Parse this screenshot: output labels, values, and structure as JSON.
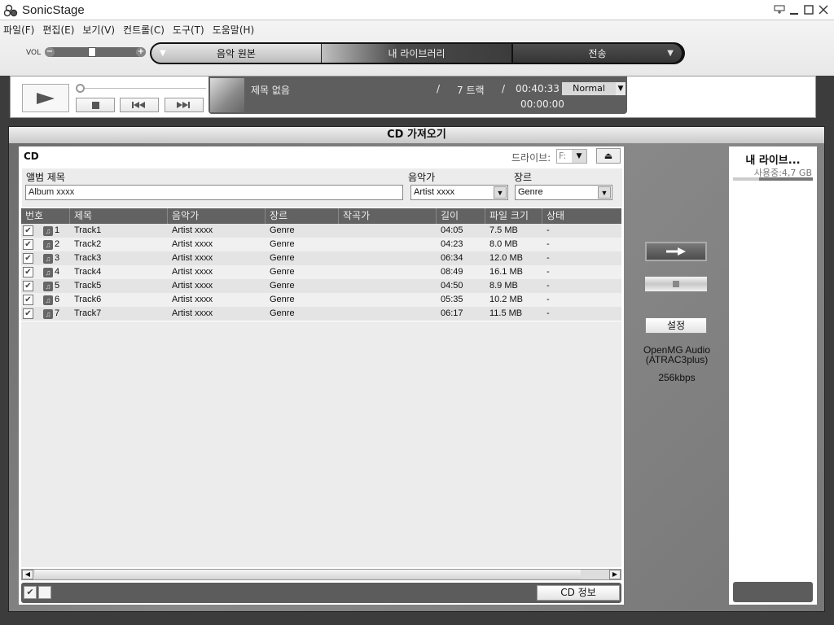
{
  "app": {
    "title": "SonicStage",
    "window_controls": [
      "mini-player",
      "minimize",
      "maximize",
      "close"
    ]
  },
  "menubar": {
    "items": [
      {
        "label": "파일(F)"
      },
      {
        "label": "편집(E)"
      },
      {
        "label": "보기(V)"
      },
      {
        "label": "컨트롤(C)"
      },
      {
        "label": "도구(T)"
      },
      {
        "label": "도움말(H)"
      }
    ]
  },
  "volume": {
    "label": "VOL",
    "minus": "−",
    "plus": "+",
    "level_percent": 45
  },
  "nav_tabs": [
    {
      "label": "음악 원본",
      "active": true
    },
    {
      "label": "내 라이브러리",
      "active": false
    },
    {
      "label": "전송",
      "active": false
    }
  ],
  "player": {
    "now_playing_title": "제목 없음",
    "separator": "/",
    "track_count": "7 트랙",
    "total_time": "00:40:33",
    "elapsed_time": "00:00:00",
    "play_mode": "Normal",
    "seek_percent": 0
  },
  "section": {
    "title": "CD 가져오기"
  },
  "cd_panel": {
    "label": "CD",
    "drive_label": "드라이브:",
    "drive_value": "F:",
    "album_label": "앨범 제목",
    "album_value": "Album xxxx",
    "artist_label": "음악가",
    "artist_value": "Artist xxxx",
    "genre_label": "장르",
    "genre_value": "Genre",
    "columns": [
      "번호",
      "제목",
      "음악가",
      "장르",
      "작곡가",
      "길이",
      "파일 크기",
      "상태"
    ],
    "tracks": [
      {
        "checked": true,
        "no": "1",
        "title": "Track1",
        "artist": "Artist xxxx",
        "genre": "Genre",
        "composer": "",
        "length": "04:05",
        "size": "7.5  MB",
        "status": "-"
      },
      {
        "checked": true,
        "no": "2",
        "title": "Track2",
        "artist": "Artist xxxx",
        "genre": "Genre",
        "composer": "",
        "length": "04:23",
        "size": "8.0  MB",
        "status": "-"
      },
      {
        "checked": true,
        "no": "3",
        "title": "Track3",
        "artist": "Artist xxxx",
        "genre": "Genre",
        "composer": "",
        "length": "06:34",
        "size": "12.0  MB",
        "status": "-"
      },
      {
        "checked": true,
        "no": "4",
        "title": "Track4",
        "artist": "Artist xxxx",
        "genre": "Genre",
        "composer": "",
        "length": "08:49",
        "size": "16.1  MB",
        "status": "-"
      },
      {
        "checked": true,
        "no": "5",
        "title": "Track5",
        "artist": "Artist xxxx",
        "genre": "Genre",
        "composer": "",
        "length": "04:50",
        "size": "8.9  MB",
        "status": "-"
      },
      {
        "checked": true,
        "no": "6",
        "title": "Track6",
        "artist": "Artist xxxx",
        "genre": "Genre",
        "composer": "",
        "length": "05:35",
        "size": "10.2  MB",
        "status": "-"
      },
      {
        "checked": true,
        "no": "7",
        "title": "Track7",
        "artist": "Artist xxxx",
        "genre": "Genre",
        "composer": "",
        "length": "06:17",
        "size": "11.5  MB",
        "status": "-"
      }
    ],
    "cd_info_button": "CD 정보"
  },
  "import_controls": {
    "settings_button": "설정",
    "codec_line1": "OpenMG Audio",
    "codec_line2": "(ATRAC3plus)",
    "bitrate": "256kbps"
  },
  "library_panel": {
    "title": "내 라이브...",
    "usage": "사용중:4,7  GB",
    "usage_fill_percent": 33
  }
}
